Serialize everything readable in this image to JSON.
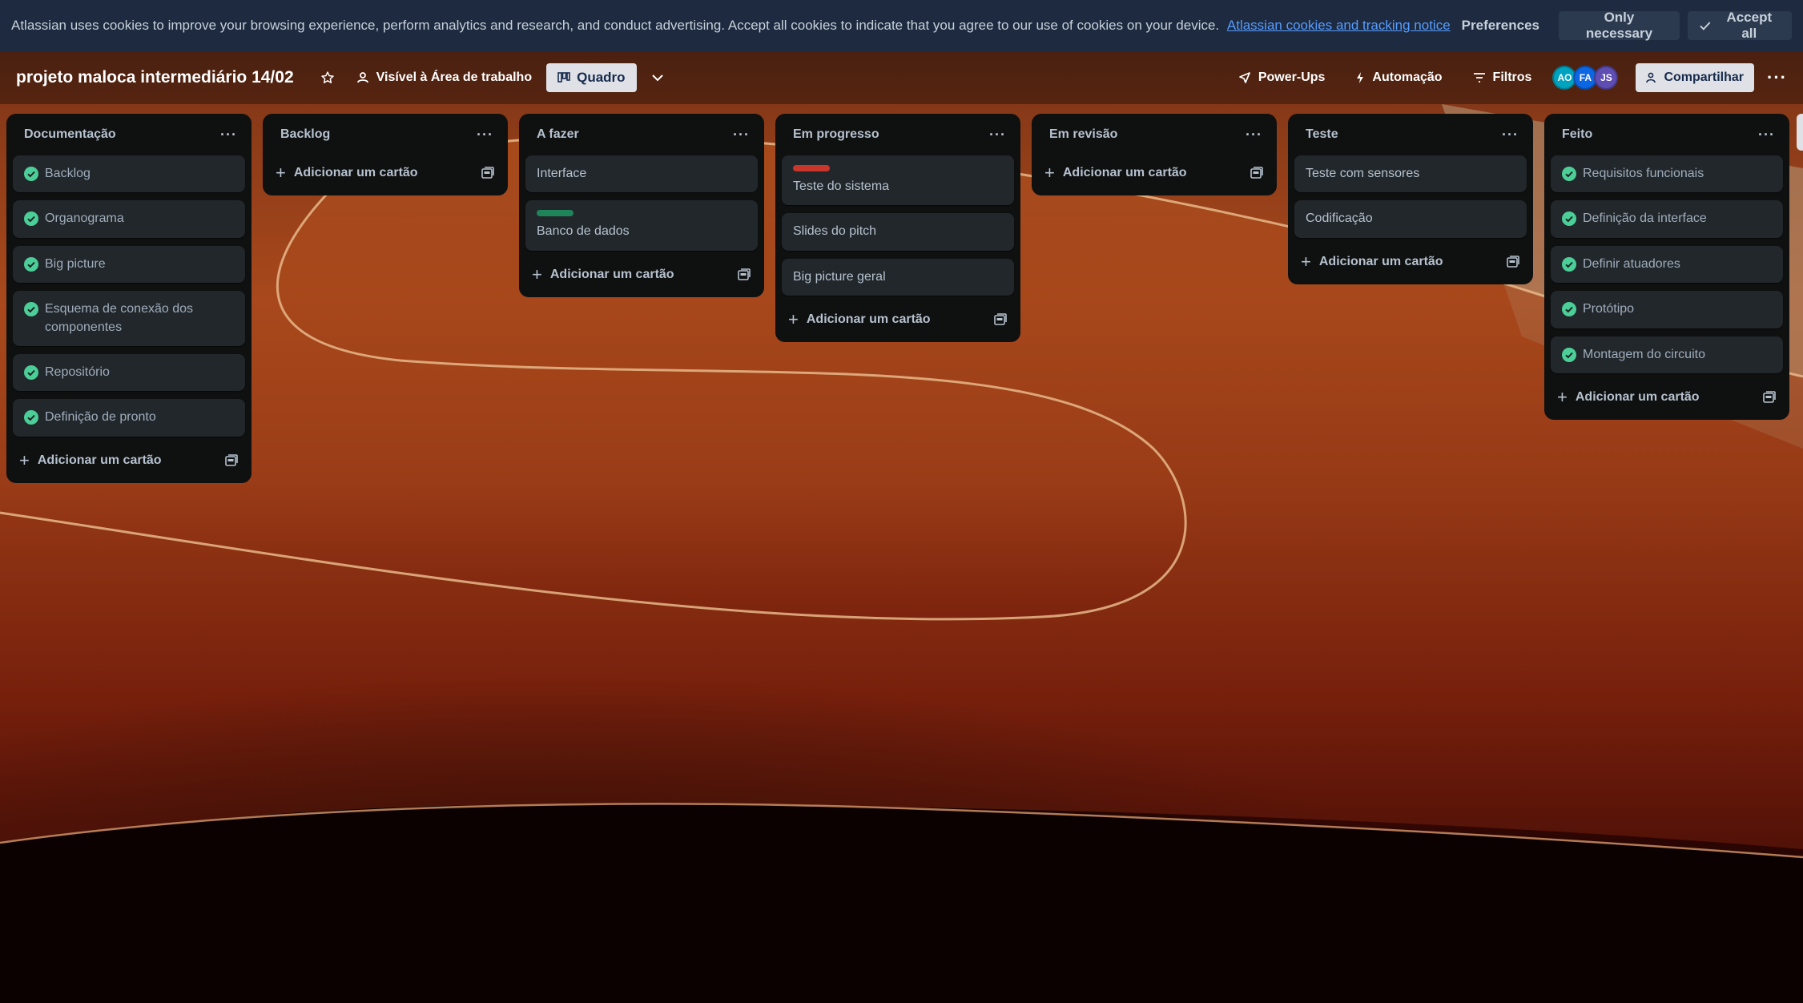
{
  "cookie_banner": {
    "text": "Atlassian uses cookies to improve your browsing experience, perform analytics and research, and conduct advertising. Accept all cookies to indicate that you agree to our use of cookies on your device.",
    "link": "Atlassian cookies and tracking notice",
    "preferences": "Preferences",
    "only_necessary": "Only necessary",
    "accept_all": "Accept all"
  },
  "header": {
    "board_title": "projeto maloca intermediário 14/02",
    "star_icon": "star-icon",
    "visibility": "Visível à Área de trabalho",
    "view": "Quadro",
    "power_ups": "Power-Ups",
    "automation": "Automação",
    "filters": "Filtros",
    "members": [
      {
        "initials": "AO",
        "color": "#00a3bf"
      },
      {
        "initials": "FA",
        "color": "#0c66e4"
      },
      {
        "initials": "JS",
        "color": "#5e4db2"
      }
    ],
    "share": "Compartilhar"
  },
  "add_card_label": "Adicionar um cartão",
  "lists": [
    {
      "title": "Documentação",
      "cards": [
        {
          "text": "Backlog",
          "done": true
        },
        {
          "text": "Organograma",
          "done": true
        },
        {
          "text": "Big picture",
          "done": true
        },
        {
          "text": "Esquema de conexão dos componentes",
          "done": true
        },
        {
          "text": "Repositório",
          "done": true
        },
        {
          "text": "Definição de pronto",
          "done": true
        }
      ]
    },
    {
      "title": "Backlog",
      "cards": []
    },
    {
      "title": "A fazer",
      "cards": [
        {
          "text": "Interface",
          "done": false
        },
        {
          "text": "Banco de dados",
          "done": false,
          "label_color": "#1f845a"
        }
      ]
    },
    {
      "title": "Em progresso",
      "cards": [
        {
          "text": "Teste do sistema",
          "done": false,
          "label_color": "#c9372c"
        },
        {
          "text": "Slides do pitch",
          "done": false
        },
        {
          "text": "Big picture geral",
          "done": false
        }
      ]
    },
    {
      "title": "Em revisão",
      "cards": []
    },
    {
      "title": "Teste",
      "cards": [
        {
          "text": "Teste com sensores",
          "done": false
        },
        {
          "text": "Codificação",
          "done": false
        }
      ]
    },
    {
      "title": "Feito",
      "cards": [
        {
          "text": "Requisitos funcionais",
          "done": true
        },
        {
          "text": "Definição da interface",
          "done": true
        },
        {
          "text": "Definir atuadores",
          "done": true
        },
        {
          "text": "Protótipo",
          "done": true
        },
        {
          "text": "Montagem do circuito",
          "done": true
        }
      ]
    }
  ],
  "colors": {
    "done_green": "#4bce97",
    "list_bg": "#0f1010",
    "card_bg": "#22272b",
    "cookie_bg": "#1d2a3f",
    "link_blue": "#579dff"
  }
}
